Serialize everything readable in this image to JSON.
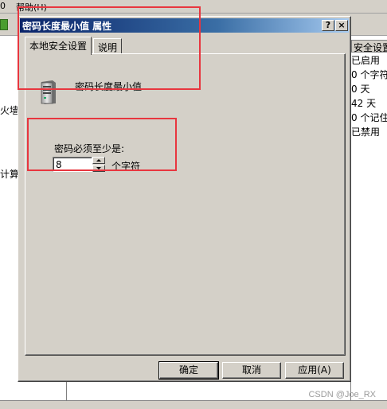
{
  "background": {
    "menu_fragments": [
      "0",
      "帮助(H)"
    ],
    "left_fragments": [
      "火墙",
      "计算"
    ],
    "right_column": {
      "header": "安全设置",
      "cells": [
        "已启用",
        "0 个字符",
        "0 天",
        "42 天",
        "0 个记住",
        "已禁用"
      ]
    },
    "watermark": "CSDN @Joe_RX"
  },
  "dialog": {
    "title": "密码长度最小值 属性",
    "help_button": "?",
    "close_button": "×",
    "tabs": [
      {
        "label": "本地安全设置",
        "active": true
      },
      {
        "label": "说明",
        "active": false
      }
    ],
    "policy_icon": "server-icon",
    "policy_name": "密码长度最小值",
    "field_label": "密码必须至少是:",
    "value": "8",
    "unit": "个字符",
    "buttons": {
      "ok": "确定",
      "cancel": "取消",
      "apply": "应用(A)"
    }
  },
  "colors": {
    "window_face": "#d4d0c8",
    "titlebar_start": "#0a246a",
    "titlebar_end": "#a6caf0",
    "annotation": "#e8363f"
  }
}
